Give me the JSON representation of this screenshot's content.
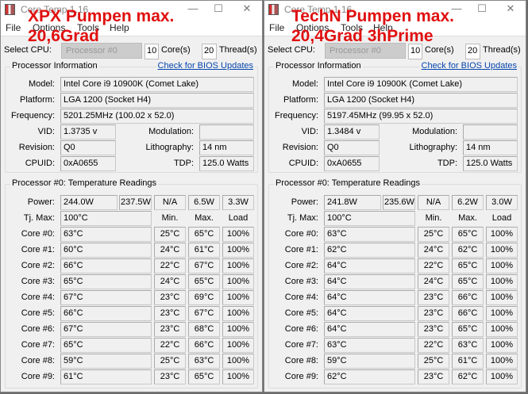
{
  "windows": [
    {
      "title": "Core Temp 1.16",
      "overlay": [
        "XPX Pumpen max.",
        "20,6Grad"
      ],
      "menu": [
        "File",
        "Options",
        "Tools",
        "Help"
      ],
      "select_cpu_label": "Select CPU:",
      "processor": "Processor #0",
      "cores": "10",
      "cores_label": "Core(s)",
      "threads": "20",
      "threads_label": "Thread(s)",
      "info_title": "Processor Information",
      "bios_link": "Check for BIOS Updates",
      "model_label": "Model:",
      "model": "Intel Core i9 10900K (Comet Lake)",
      "platform_label": "Platform:",
      "platform": "LGA 1200 (Socket H4)",
      "frequency_label": "Frequency:",
      "frequency": "5201.25MHz (100.02 x 52.0)",
      "vid_label": "VID:",
      "vid": "1.3735 v",
      "modulation_label": "Modulation:",
      "modulation": "",
      "revision_label": "Revision:",
      "revision": "Q0",
      "lithography_label": "Lithography:",
      "lithography": "14 nm",
      "cpuid_label": "CPUID:",
      "cpuid": "0xA0655",
      "tdp_label": "TDP:",
      "tdp": "125.0 Watts",
      "temp_title": "Processor #0: Temperature Readings",
      "power_label": "Power:",
      "power": [
        "244.0W",
        "237.5W",
        "N/A",
        "6.5W",
        "3.3W"
      ],
      "tjmax_label": "Tj. Max:",
      "tjmax": "100°C",
      "min_label": "Min.",
      "max_label": "Max.",
      "load_label": "Load",
      "cores_rows": [
        {
          "label": "Core #0:",
          "temp": "63°C",
          "min": "25°C",
          "max": "65°C",
          "load": "100%"
        },
        {
          "label": "Core #1:",
          "temp": "60°C",
          "min": "24°C",
          "max": "61°C",
          "load": "100%"
        },
        {
          "label": "Core #2:",
          "temp": "66°C",
          "min": "22°C",
          "max": "67°C",
          "load": "100%"
        },
        {
          "label": "Core #3:",
          "temp": "65°C",
          "min": "24°C",
          "max": "65°C",
          "load": "100%"
        },
        {
          "label": "Core #4:",
          "temp": "67°C",
          "min": "23°C",
          "max": "69°C",
          "load": "100%"
        },
        {
          "label": "Core #5:",
          "temp": "66°C",
          "min": "23°C",
          "max": "67°C",
          "load": "100%"
        },
        {
          "label": "Core #6:",
          "temp": "67°C",
          "min": "23°C",
          "max": "68°C",
          "load": "100%"
        },
        {
          "label": "Core #7:",
          "temp": "65°C",
          "min": "22°C",
          "max": "66°C",
          "load": "100%"
        },
        {
          "label": "Core #8:",
          "temp": "59°C",
          "min": "25°C",
          "max": "63°C",
          "load": "100%"
        },
        {
          "label": "Core #9:",
          "temp": "61°C",
          "min": "23°C",
          "max": "65°C",
          "load": "100%"
        }
      ]
    },
    {
      "title": "Core Temp 1.16",
      "overlay": [
        "TechN Pumpen max.",
        "20,4Grad 3hPrime"
      ],
      "menu": [
        "File",
        "Options",
        "Tools",
        "Help"
      ],
      "select_cpu_label": "Select CPU:",
      "processor": "Processor #0",
      "cores": "10",
      "cores_label": "Core(s)",
      "threads": "20",
      "threads_label": "Thread(s)",
      "info_title": "Processor Information",
      "bios_link": "Check for BIOS Updates",
      "model_label": "Model:",
      "model": "Intel Core i9 10900K (Comet Lake)",
      "platform_label": "Platform:",
      "platform": "LGA 1200 (Socket H4)",
      "frequency_label": "Frequency:",
      "frequency": "5197.45MHz (99.95 x 52.0)",
      "vid_label": "VID:",
      "vid": "1.3484 v",
      "modulation_label": "Modulation:",
      "modulation": "",
      "revision_label": "Revision:",
      "revision": "Q0",
      "lithography_label": "Lithography:",
      "lithography": "14 nm",
      "cpuid_label": "CPUID:",
      "cpuid": "0xA0655",
      "tdp_label": "TDP:",
      "tdp": "125.0 Watts",
      "temp_title": "Processor #0: Temperature Readings",
      "power_label": "Power:",
      "power": [
        "241.8W",
        "235.6W",
        "N/A",
        "6.2W",
        "3.0W"
      ],
      "tjmax_label": "Tj. Max:",
      "tjmax": "100°C",
      "min_label": "Min.",
      "max_label": "Max.",
      "load_label": "Load",
      "cores_rows": [
        {
          "label": "Core #0:",
          "temp": "63°C",
          "min": "25°C",
          "max": "65°C",
          "load": "100%"
        },
        {
          "label": "Core #1:",
          "temp": "62°C",
          "min": "24°C",
          "max": "62°C",
          "load": "100%"
        },
        {
          "label": "Core #2:",
          "temp": "64°C",
          "min": "22°C",
          "max": "65°C",
          "load": "100%"
        },
        {
          "label": "Core #3:",
          "temp": "64°C",
          "min": "24°C",
          "max": "65°C",
          "load": "100%"
        },
        {
          "label": "Core #4:",
          "temp": "64°C",
          "min": "23°C",
          "max": "66°C",
          "load": "100%"
        },
        {
          "label": "Core #5:",
          "temp": "64°C",
          "min": "23°C",
          "max": "66°C",
          "load": "100%"
        },
        {
          "label": "Core #6:",
          "temp": "64°C",
          "min": "23°C",
          "max": "65°C",
          "load": "100%"
        },
        {
          "label": "Core #7:",
          "temp": "63°C",
          "min": "22°C",
          "max": "63°C",
          "load": "100%"
        },
        {
          "label": "Core #8:",
          "temp": "59°C",
          "min": "25°C",
          "max": "61°C",
          "load": "100%"
        },
        {
          "label": "Core #9:",
          "temp": "62°C",
          "min": "23°C",
          "max": "62°C",
          "load": "100%"
        }
      ]
    }
  ]
}
